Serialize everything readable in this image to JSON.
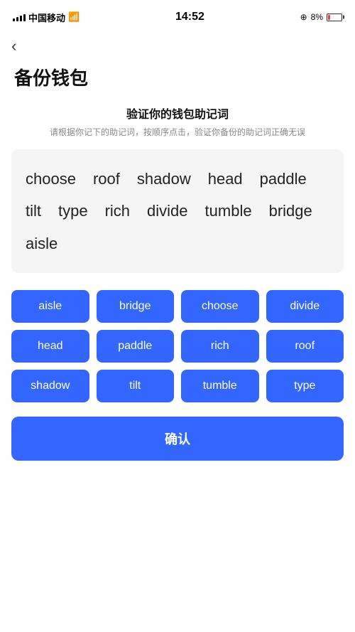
{
  "statusBar": {
    "carrier": "中国移动",
    "time": "14:52",
    "battery": "8%"
  },
  "back": "‹",
  "title": "备份钱包",
  "sectionTitle": "验证你的钱包助记词",
  "sectionDesc": "请根据你记下的助记词，按顺序点击，验证你备份的助记词正确无误",
  "displayWords": [
    "choose",
    "roof",
    "shadow",
    "head",
    "paddle",
    "tilt",
    "type",
    "rich",
    "divide",
    "tumble",
    "bridge",
    "aisle"
  ],
  "wordButtons": [
    "aisle",
    "bridge",
    "choose",
    "divide",
    "head",
    "paddle",
    "rich",
    "roof",
    "shadow",
    "tilt",
    "tumble",
    "type"
  ],
  "confirmLabel": "确认"
}
